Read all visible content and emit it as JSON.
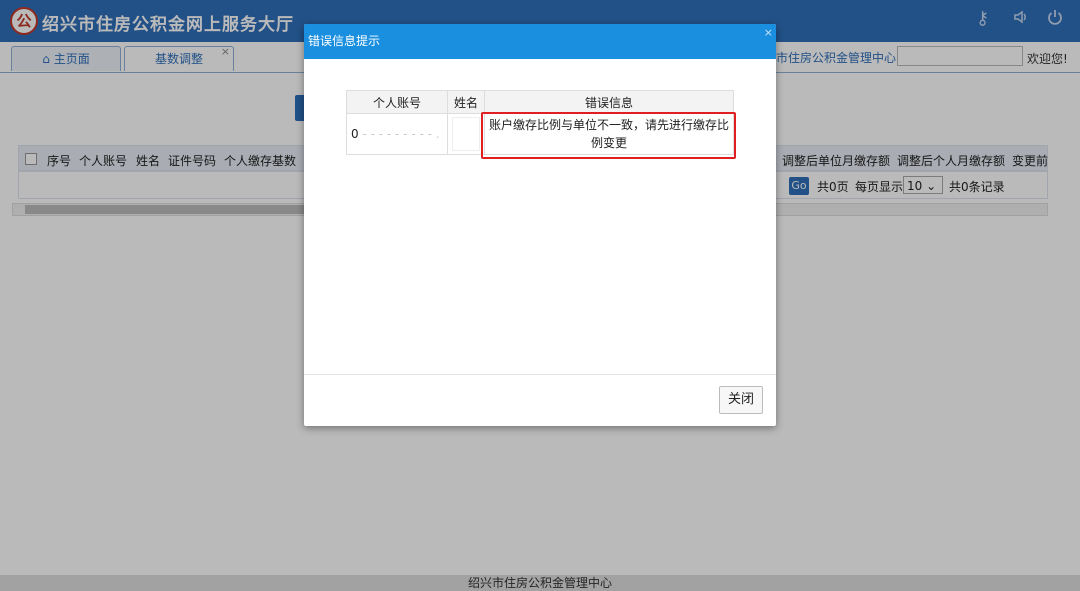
{
  "header": {
    "title": "绍兴市住房公积金网上服务大厅",
    "logo_glyph": "公",
    "icons": [
      "key-icon",
      "speaker-icon",
      "power-icon"
    ]
  },
  "tabs": [
    {
      "label": "主页面",
      "icon": "home-icon"
    },
    {
      "label": "基数调整",
      "close": "×"
    }
  ],
  "topright": {
    "center_name": "市住房公积金管理中心",
    "welcome": "欢迎您!"
  },
  "grid": {
    "headers": [
      "序号",
      "个人账号",
      "姓名",
      "证件号码",
      "个人缴存基数"
    ],
    "right_headers": [
      "调整后单位月缴存额",
      "调整后个人月缴存额",
      "变更前"
    ],
    "pager": {
      "go": "Go",
      "pages": "共0页",
      "per_page_label": "每页显示",
      "per_page_value": "10",
      "records": "共0条记录"
    }
  },
  "modal": {
    "title": "错误信息提示",
    "columns": [
      "个人账号",
      "姓名",
      "错误信息"
    ],
    "rows": [
      {
        "account": "0",
        "name": "",
        "error": "账户缴存比例与单位不一致，请先进行缴存比例变更"
      }
    ],
    "close_label": "关闭",
    "close_x": "×"
  },
  "footer": {
    "text": "绍兴市住房公积金管理中心"
  }
}
